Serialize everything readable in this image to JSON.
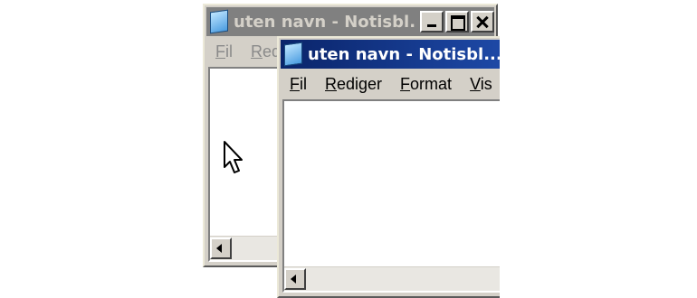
{
  "back_window": {
    "title": "uten navn - Notisbl...",
    "menu": [
      "Fil",
      "Red"
    ]
  },
  "front_window": {
    "title": "uten navn - Notisbl...",
    "menu": [
      "Fil",
      "Rediger",
      "Format",
      "Vis"
    ]
  },
  "icons": {
    "app": "notepad-icon",
    "minimize": "minimize-icon",
    "maximize": "maximize-icon",
    "close": "close-icon",
    "scroll_left": "scroll-left-arrow-icon",
    "cursor": "mouse-pointer-icon"
  },
  "colors": {
    "active_titlebar": "#0a246a",
    "inactive_titlebar": "#808080",
    "window_face": "#d4d0c8"
  }
}
